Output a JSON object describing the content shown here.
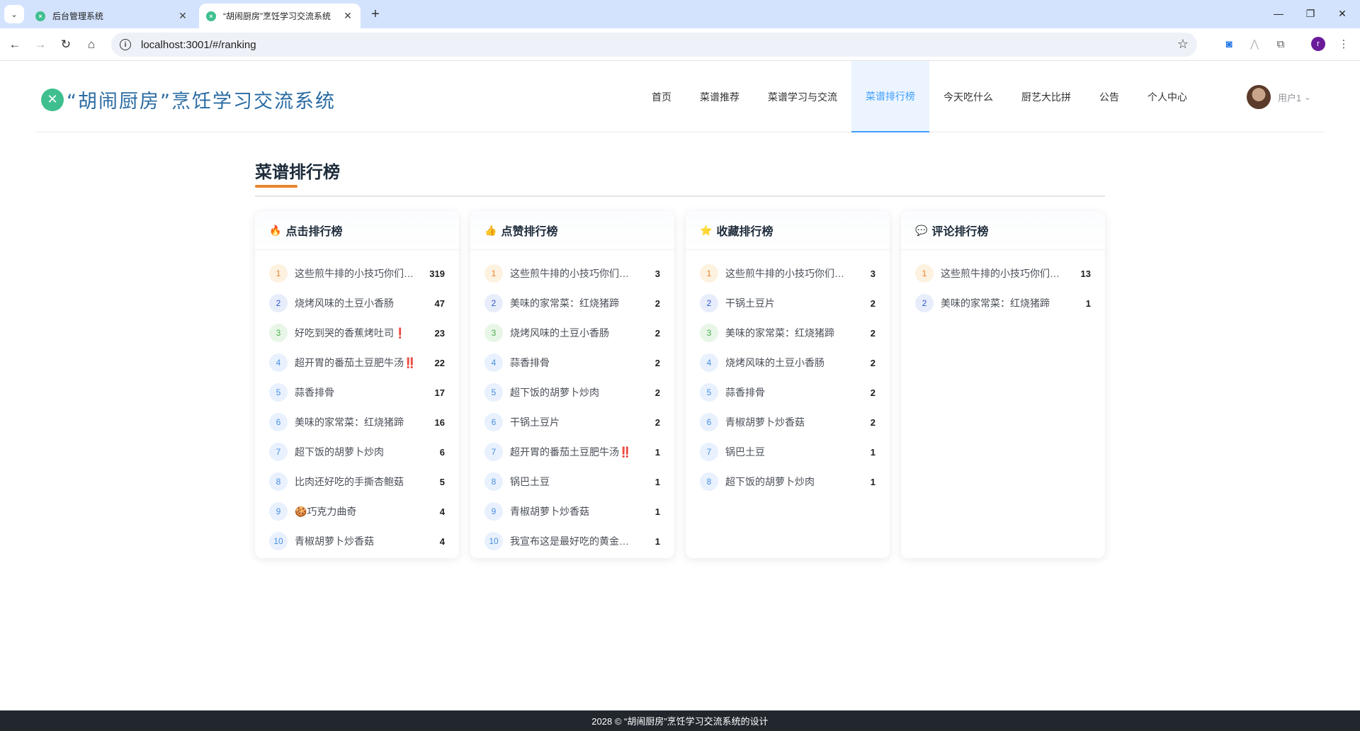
{
  "browser": {
    "tabs": [
      {
        "title": "后台管理系统"
      },
      {
        "title": "“胡闹厨房”烹饪学习交流系统"
      }
    ],
    "new_tab_glyph": "+",
    "url": "localhost:3001/#/ranking",
    "profile_initial": "r"
  },
  "site": {
    "logo_text": "“胡闹厨房”烹饪学习交流系统",
    "nav": [
      {
        "label": "首页"
      },
      {
        "label": "菜谱推荐"
      },
      {
        "label": "菜谱学习与交流"
      },
      {
        "label": "菜谱排行榜"
      },
      {
        "label": "今天吃什么"
      },
      {
        "label": "厨艺大比拼"
      },
      {
        "label": "公告"
      },
      {
        "label": "个人中心"
      }
    ],
    "active_nav": "菜谱排行榜",
    "user_name": "用户1"
  },
  "page": {
    "title": "菜谱排行榜"
  },
  "rankings": [
    {
      "title": "点击排行榜",
      "icon": "fire-icon",
      "items": [
        {
          "rank": "1",
          "name": "这些煎牛排的小技巧你们都知道吗",
          "value": "319"
        },
        {
          "rank": "2",
          "name": "烧烤风味的土豆小香肠",
          "value": "47"
        },
        {
          "rank": "3",
          "name": "好吃到哭的香蕉烤吐司❗",
          "value": "23"
        },
        {
          "rank": "4",
          "name": "超开胃的番茄土豆肥牛汤‼️",
          "value": "22"
        },
        {
          "rank": "5",
          "name": "蒜香排骨",
          "value": "17"
        },
        {
          "rank": "6",
          "name": "美味的家常菜：红烧猪蹄",
          "value": "16"
        },
        {
          "rank": "7",
          "name": "超下饭的胡萝卜炒肉",
          "value": "6"
        },
        {
          "rank": "8",
          "name": "比肉还好吃的手撕杏鲍菇",
          "value": "5"
        },
        {
          "rank": "9",
          "name": "🍪巧克力曲奇",
          "value": "4"
        },
        {
          "rank": "10",
          "name": "青椒胡萝卜炒香菇",
          "value": "4"
        }
      ]
    },
    {
      "title": "点赞排行榜",
      "icon": "thumbs-up-icon",
      "items": [
        {
          "rank": "1",
          "name": "这些煎牛排的小技巧你们都知道吗",
          "value": "3"
        },
        {
          "rank": "2",
          "name": "美味的家常菜：红烧猪蹄",
          "value": "2"
        },
        {
          "rank": "3",
          "name": "烧烤风味的土豆小香肠",
          "value": "2"
        },
        {
          "rank": "4",
          "name": "蒜香排骨",
          "value": "2"
        },
        {
          "rank": "5",
          "name": "超下饭的胡萝卜炒肉",
          "value": "2"
        },
        {
          "rank": "6",
          "name": "干锅土豆片",
          "value": "2"
        },
        {
          "rank": "7",
          "name": "超开胃的番茄土豆肥牛汤‼️",
          "value": "1"
        },
        {
          "rank": "8",
          "name": "锅巴土豆",
          "value": "1"
        },
        {
          "rank": "9",
          "name": "青椒胡萝卜炒香菇",
          "value": "1"
        },
        {
          "rank": "10",
          "name": "我宣布这是最好吃的黄金椰子鸡",
          "value": "1"
        }
      ]
    },
    {
      "title": "收藏排行榜",
      "icon": "star-icon",
      "items": [
        {
          "rank": "1",
          "name": "这些煎牛排的小技巧你们都知道吗",
          "value": "3"
        },
        {
          "rank": "2",
          "name": "干锅土豆片",
          "value": "2"
        },
        {
          "rank": "3",
          "name": "美味的家常菜：红烧猪蹄",
          "value": "2"
        },
        {
          "rank": "4",
          "name": "烧烤风味的土豆小香肠",
          "value": "2"
        },
        {
          "rank": "5",
          "name": "蒜香排骨",
          "value": "2"
        },
        {
          "rank": "6",
          "name": "青椒胡萝卜炒香菇",
          "value": "2"
        },
        {
          "rank": "7",
          "name": "锅巴土豆",
          "value": "1"
        },
        {
          "rank": "8",
          "name": "超下饭的胡萝卜炒肉",
          "value": "1"
        }
      ]
    },
    {
      "title": "评论排行榜",
      "icon": "speech-bubble-icon",
      "items": [
        {
          "rank": "1",
          "name": "这些煎牛排的小技巧你们都知道吗",
          "value": "13"
        },
        {
          "rank": "2",
          "name": "美味的家常菜：红烧猪蹄",
          "value": "1"
        }
      ]
    }
  ],
  "footer": {
    "text": "2028 © “胡闹厨房”烹饪学习交流系统的设计"
  },
  "colors": {
    "accent": "#409eff",
    "title_underline": "#e6852c",
    "logo_green": "#3fbf8f",
    "logo_text": "#2a6ba3",
    "footer_bg": "#22272e"
  }
}
